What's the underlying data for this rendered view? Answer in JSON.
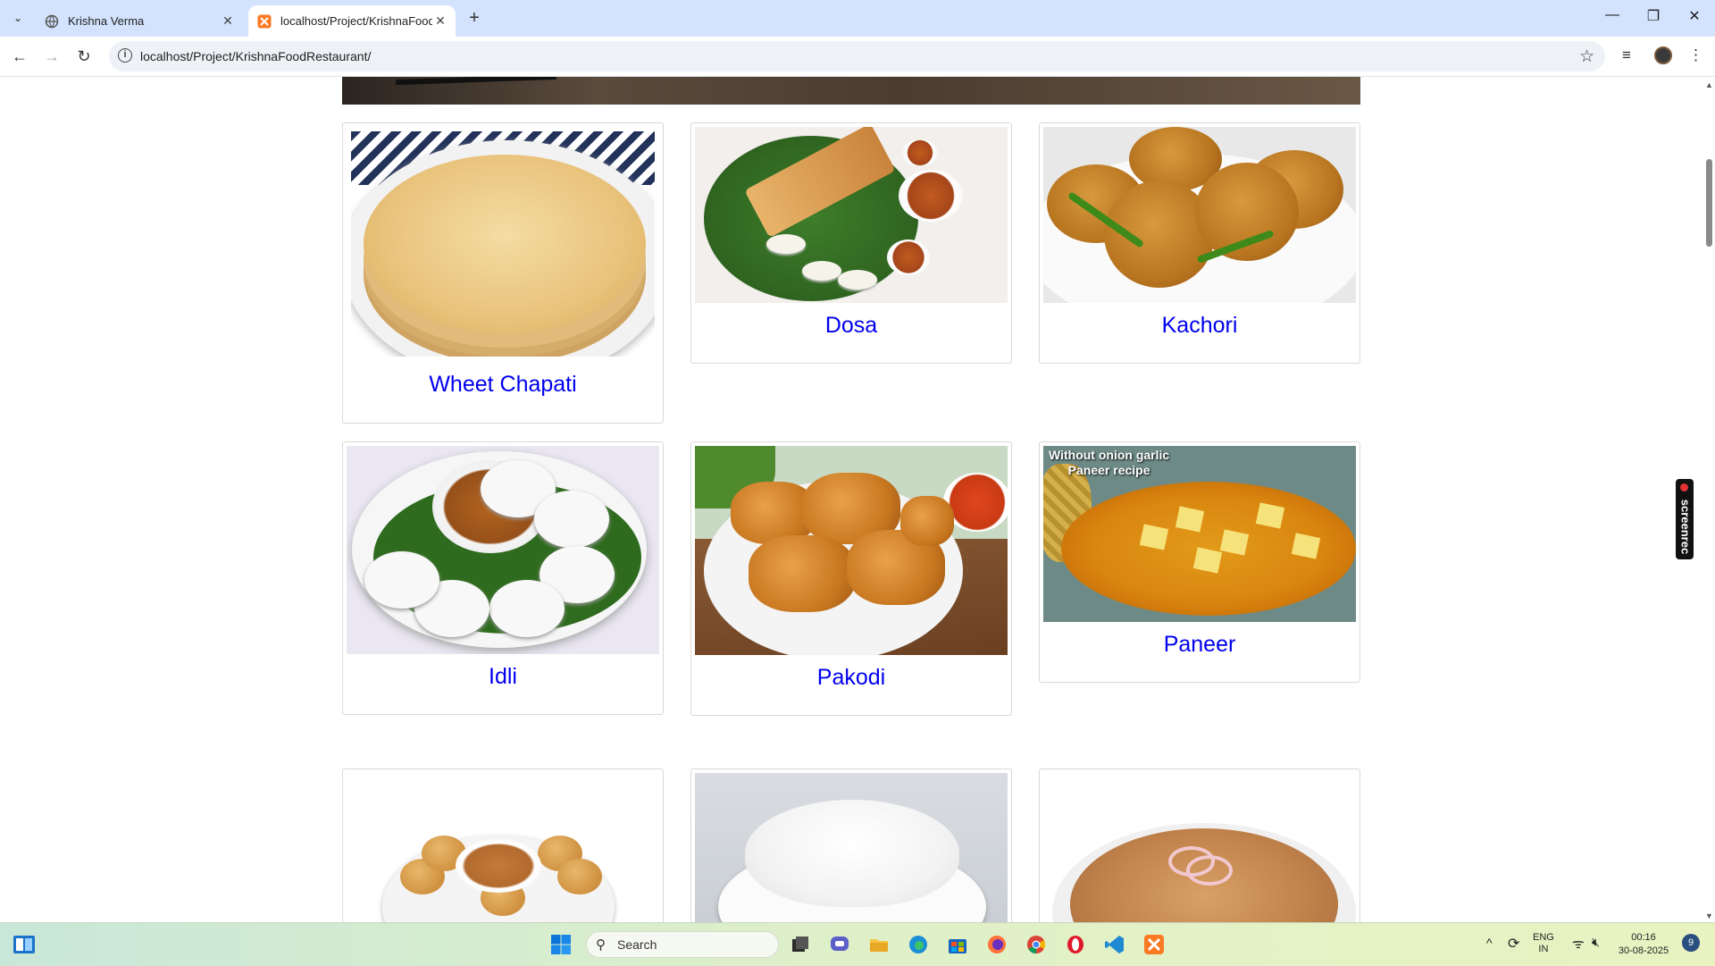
{
  "browser": {
    "tabs": [
      {
        "label": "Krishna Verma",
        "active": false,
        "icon": "globe-icon"
      },
      {
        "label": "localhost/Project/KrishnaFoodR",
        "active": true,
        "icon": "xampp-icon"
      }
    ],
    "address": "localhost/Project/KrishnaFoodRestaurant/"
  },
  "menu": {
    "items": [
      {
        "name": "Wheet Chapati",
        "image": "chapati"
      },
      {
        "name": "Dosa",
        "image": "dosa"
      },
      {
        "name": "Kachori",
        "image": "kachori"
      },
      {
        "name": "Idli",
        "image": "idli"
      },
      {
        "name": "Pakodi",
        "image": "pakodi"
      },
      {
        "name": "Paneer",
        "image": "paneer"
      },
      {
        "name": "",
        "image": "pani-puri"
      },
      {
        "name": "",
        "image": "rice"
      },
      {
        "name": "",
        "image": "paratha"
      }
    ],
    "paneer_image_caption": [
      "Without onion garlic",
      "Paneer recipe"
    ]
  },
  "screenrec": {
    "label": "screenrec"
  },
  "taskbar": {
    "search_placeholder": "Search",
    "language": [
      "ENG",
      "IN"
    ],
    "time": "00:16",
    "date": "30-08-2025",
    "notification_count": "9"
  },
  "colors": {
    "accent_link": "#0000ee",
    "tabstrip": "#d3e3fd"
  }
}
